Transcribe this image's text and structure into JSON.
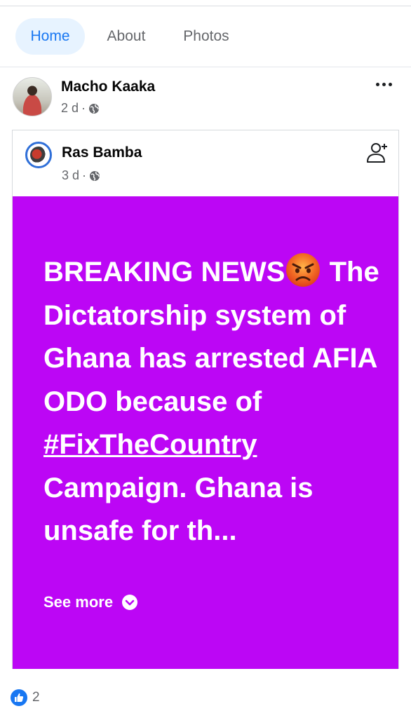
{
  "tabs": [
    {
      "label": "Home",
      "active": true
    },
    {
      "label": "About"
    },
    {
      "label": "Photos"
    }
  ],
  "post": {
    "author": "Macho Kaaka",
    "time": "2 d",
    "privacy_icon": "globe-icon",
    "more_icon": "more-options-icon",
    "shared": {
      "author": "Ras Bamba",
      "time": "3 d",
      "privacy_icon": "globe-icon",
      "action_icon": "add-friend-icon",
      "background_color": "#bc06f5",
      "text_line1": "BREAKING NEWS",
      "emoji": "angry-face",
      "text_line2": "The Dictatorship system of Ghana has arrested AFIA ODO because of",
      "hashtag": "#FixTheCountry",
      "text_line3": "Campaign. Ghana is unsafe  for th...",
      "see_more": "See more"
    },
    "reactions": {
      "icon": "like-icon",
      "count": "2"
    }
  },
  "colors": {
    "accent": "#1877f2",
    "post_background": "#bc06f5",
    "secondary_text": "#65676b"
  }
}
